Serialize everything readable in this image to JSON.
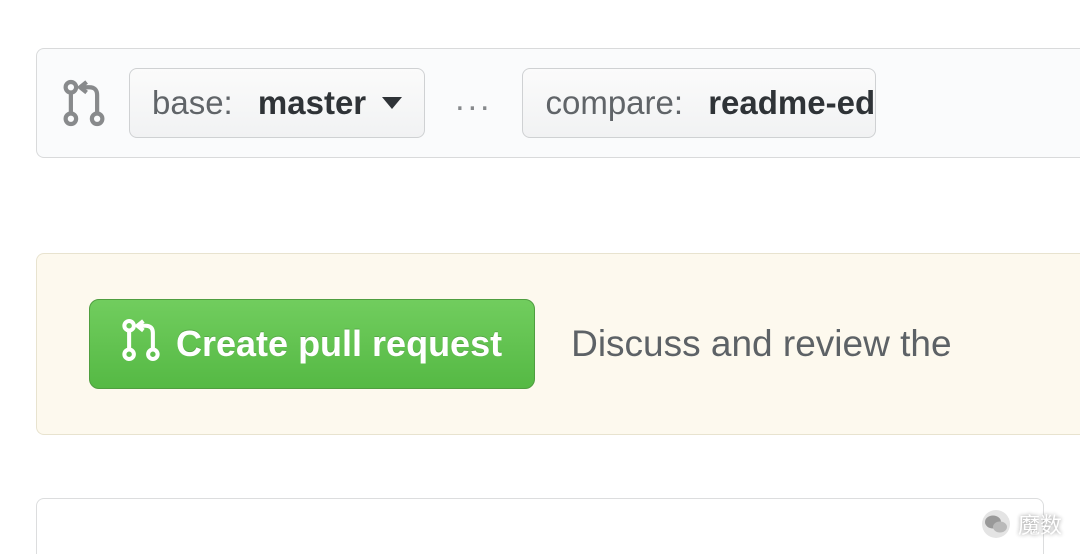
{
  "compare_bar": {
    "base": {
      "label": "base:",
      "value": "master"
    },
    "separator": "...",
    "compare": {
      "label": "compare:",
      "value": "readme-ed"
    }
  },
  "action_panel": {
    "button_label": "Create pull request",
    "description": "Discuss and review the"
  },
  "watermark": {
    "text": "魔数"
  }
}
